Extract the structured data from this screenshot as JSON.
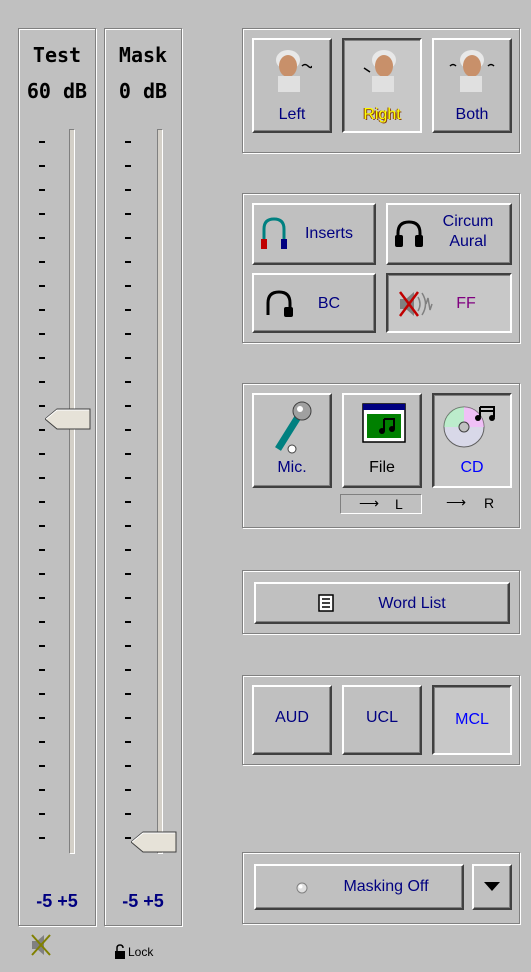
{
  "test_slider": {
    "title": "Test",
    "value": "60 dB",
    "step_label": "-5 +5"
  },
  "mask_slider": {
    "title": "Mask",
    "value": "0 dB",
    "step_label": "-5 +5"
  },
  "ear_select": {
    "left": "Left",
    "right": "Right",
    "both": "Both"
  },
  "transducer": {
    "inserts": "Inserts",
    "circum_line1": "Circum",
    "circum_line2": "Aural",
    "bc": "BC",
    "ff": "FF"
  },
  "source": {
    "mic": "Mic.",
    "file": "File",
    "cd": "CD",
    "file_route": "L",
    "cd_route": "R"
  },
  "word_list": {
    "label": "Word List"
  },
  "mode": {
    "aud": "AUD",
    "ucl": "UCL",
    "mcl": "MCL"
  },
  "masking": {
    "label": "Masking Off"
  },
  "footer": {
    "lock": "Lock"
  },
  "colors": {
    "label": "#000080",
    "active_right": "#ffff00",
    "active_mcl": "#0000ff"
  }
}
